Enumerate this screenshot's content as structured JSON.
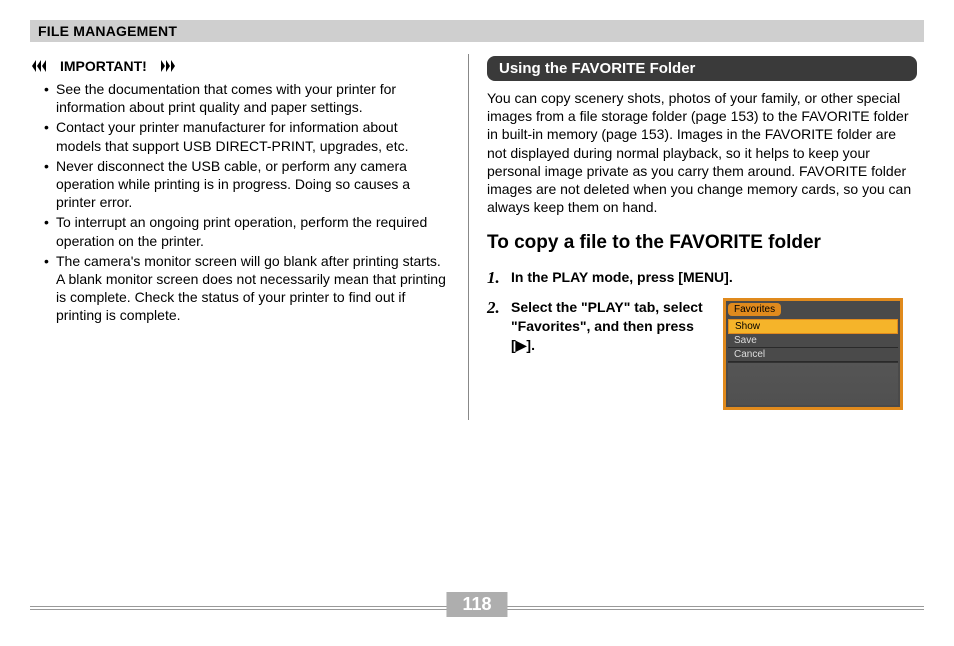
{
  "chapter": "FILE MANAGEMENT",
  "left": {
    "important_label": "IMPORTANT!",
    "bullets": [
      "See the documentation that comes with your printer for information about print quality and paper settings.",
      "Contact your printer manufacturer for information about models that support USB DIRECT-PRINT, upgrades, etc.",
      "Never disconnect the USB cable, or perform any camera operation while printing is in progress. Doing so causes a printer error.",
      "To interrupt an ongoing print operation, perform the required operation on the printer.",
      "The camera's monitor screen will go blank after printing starts. A blank monitor screen does not necessarily mean that printing is complete. Check the status of your printer to find out if printing is complete."
    ]
  },
  "right": {
    "section_title": "Using the FAVORITE Folder",
    "paragraph": "You can copy scenery shots, photos of your family, or other special images from a file storage folder (page 153) to the FAVORITE folder in built-in memory (page 153). Images in the FAVORITE folder are not displayed during normal playback, so it helps to keep your personal image private as you carry them around. FAVORITE folder images are not deleted when you change memory cards, so you can always keep them on hand.",
    "heading": "To copy a file to the FAVORITE folder",
    "steps": {
      "s1": "In the PLAY mode, press [MENU].",
      "s2": "Select the \"PLAY\" tab, select \"Favorites\", and then press [▶]."
    },
    "menu": {
      "tab": "Favorites",
      "item1": "Show",
      "item2": "Save",
      "item3": "Cancel"
    }
  },
  "page": "118"
}
